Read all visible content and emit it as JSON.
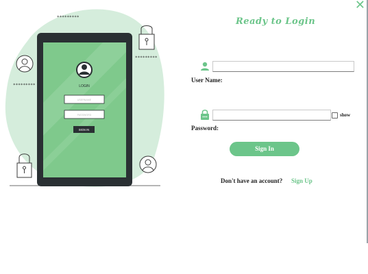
{
  "window": {
    "close_icon": "close-icon",
    "close_glyph": "✕"
  },
  "illustration": {
    "stars_top": "*********",
    "stars_right": "*********",
    "stars_left": "*********",
    "screen_title": "LOGIN",
    "screen_username_placeholder": "USERNAME",
    "screen_password_placeholder": "PASSWORD",
    "screen_button": "SIGN IN"
  },
  "form": {
    "title": "Ready to Login",
    "username_label": "User Name:",
    "username_value": "",
    "password_label": "Password:",
    "password_value": "",
    "show_label": "show",
    "show_checked": false,
    "signin_label": "Sign In",
    "no_account_text": "Don't have an account?",
    "signup_label": "Sign Up"
  },
  "colors": {
    "accent": "#6cc58a",
    "blob": "#d5eddc",
    "tablet_frame": "#2a3033",
    "screen": "#7fc98c"
  }
}
